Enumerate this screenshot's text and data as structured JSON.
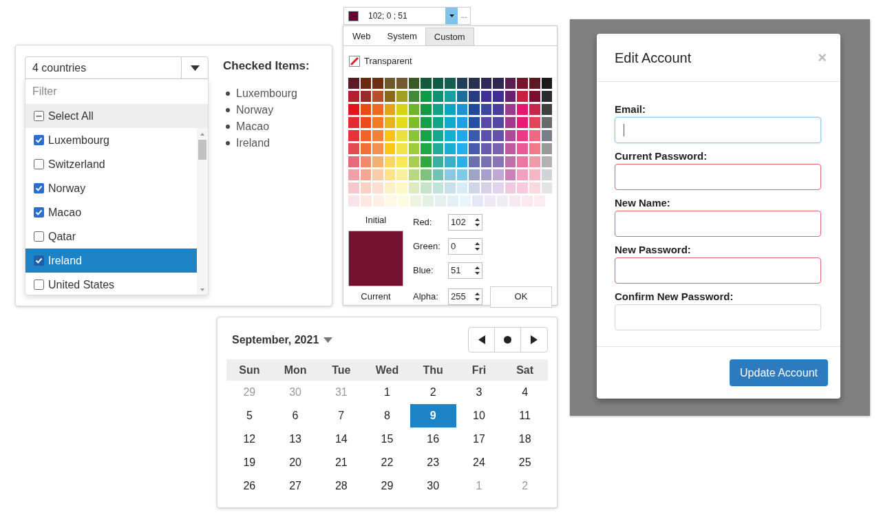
{
  "country_select": {
    "summary": "4 countries",
    "filter_placeholder": "Filter",
    "select_all": {
      "label": "Select All",
      "indeterminate": true
    },
    "items": [
      {
        "label": "Luxembourg",
        "checked": true,
        "selected": false
      },
      {
        "label": "Switzerland",
        "checked": false,
        "selected": false
      },
      {
        "label": "Norway",
        "checked": true,
        "selected": false
      },
      {
        "label": "Macao",
        "checked": true,
        "selected": false
      },
      {
        "label": "Qatar",
        "checked": false,
        "selected": false
      },
      {
        "label": "Ireland",
        "checked": true,
        "selected": true
      },
      {
        "label": "United States",
        "checked": false,
        "selected": false
      }
    ]
  },
  "checked_items": {
    "title": "Checked Items:",
    "items": [
      "Luxembourg",
      "Norway",
      "Macao",
      "Ireland"
    ]
  },
  "color_combo": {
    "value": "102; 0 ; 51",
    "color": "#660033",
    "more": "..."
  },
  "color_picker": {
    "tabs": [
      {
        "label": "Web",
        "selected": false
      },
      {
        "label": "System",
        "selected": false
      },
      {
        "label": "Custom",
        "selected": true
      }
    ],
    "transparent": "Transparent",
    "palette": [
      {
        "swatches": [
          {
            "color": "#5e1a24"
          },
          {
            "color": "#6b2a10"
          },
          {
            "color": "#6f2e0f"
          },
          {
            "color": "#6e5a2a"
          },
          {
            "color": "#735a32"
          },
          {
            "color": "#3a5a25"
          },
          {
            "color": "#125a3a"
          },
          {
            "color": "#0f5c46"
          },
          {
            "color": "#165e50"
          },
          {
            "color": "#233e5a"
          },
          {
            "color": "#2b2f50"
          },
          {
            "color": "#30275a"
          },
          {
            "color": "#2f2852"
          },
          {
            "color": "#5a1f4e"
          },
          {
            "color": "#74142f"
          },
          {
            "color": "#5e1a24"
          },
          {
            "color": "#1a1a1a"
          }
        ]
      },
      {
        "swatches": [
          {
            "color": "#b5202f"
          },
          {
            "color": "#9a2b2b"
          },
          {
            "color": "#b5502a"
          },
          {
            "color": "#8a6a1a"
          },
          {
            "color": "#a0a020"
          },
          {
            "color": "#428a38"
          },
          {
            "color": "#0c9a48"
          },
          {
            "color": "#109070"
          },
          {
            "color": "#14a0a0"
          },
          {
            "color": "#1e6e9a"
          },
          {
            "color": "#283a80"
          },
          {
            "color": "#40309a"
          },
          {
            "color": "#402f90"
          },
          {
            "color": "#6a2070"
          },
          {
            "color": "#c8203f"
          },
          {
            "color": "#7a1030"
          },
          {
            "color": "#2a2a30"
          }
        ]
      },
      {
        "swatches": [
          {
            "color": "#e3141c"
          },
          {
            "color": "#ea4a14"
          },
          {
            "color": "#ef6a1f"
          },
          {
            "color": "#e4a418"
          },
          {
            "color": "#d8d21a"
          },
          {
            "color": "#6fb52c"
          },
          {
            "color": "#119a44"
          },
          {
            "color": "#10a284"
          },
          {
            "color": "#0aa5bf"
          },
          {
            "color": "#1b94d6"
          },
          {
            "color": "#224a9a"
          },
          {
            "color": "#3c48a0"
          },
          {
            "color": "#4a3f9a"
          },
          {
            "color": "#9c3a8e"
          },
          {
            "color": "#e3186e"
          },
          {
            "color": "#c8264a"
          },
          {
            "color": "#404040"
          }
        ]
      },
      {
        "swatches": [
          {
            "color": "#e52a30"
          },
          {
            "color": "#ec4a1a"
          },
          {
            "color": "#f07c26"
          },
          {
            "color": "#e6b41c"
          },
          {
            "color": "#e3dc1a"
          },
          {
            "color": "#7ebc2c"
          },
          {
            "color": "#12a048"
          },
          {
            "color": "#12a488"
          },
          {
            "color": "#10abcc"
          },
          {
            "color": "#1ca0e0"
          },
          {
            "color": "#2350a0"
          },
          {
            "color": "#5a4aa8"
          },
          {
            "color": "#5448a0"
          },
          {
            "color": "#a23a90"
          },
          {
            "color": "#e81a76"
          },
          {
            "color": "#e0465a"
          },
          {
            "color": "#6a6a6a"
          }
        ]
      },
      {
        "swatches": [
          {
            "color": "#e83238"
          },
          {
            "color": "#f0642a"
          },
          {
            "color": "#f18238"
          },
          {
            "color": "#fac316"
          },
          {
            "color": "#e8e03c"
          },
          {
            "color": "#8ac43a"
          },
          {
            "color": "#14a24a"
          },
          {
            "color": "#14a890"
          },
          {
            "color": "#12b0d0"
          },
          {
            "color": "#1eaaea"
          },
          {
            "color": "#3a5aaa"
          },
          {
            "color": "#5a52aa"
          },
          {
            "color": "#6452a8"
          },
          {
            "color": "#b04a98"
          },
          {
            "color": "#ea3a86"
          },
          {
            "color": "#ee6a80"
          },
          {
            "color": "#7a7e88"
          }
        ]
      },
      {
        "swatches": [
          {
            "color": "#e44a52"
          },
          {
            "color": "#f07038"
          },
          {
            "color": "#f39050"
          },
          {
            "color": "#fcc818"
          },
          {
            "color": "#f0e44a"
          },
          {
            "color": "#9ccc3c"
          },
          {
            "color": "#20a848"
          },
          {
            "color": "#20ac98"
          },
          {
            "color": "#1aaed4"
          },
          {
            "color": "#20aeec"
          },
          {
            "color": "#4a5aaa"
          },
          {
            "color": "#6a5aae"
          },
          {
            "color": "#7a62ae"
          },
          {
            "color": "#c05a9e"
          },
          {
            "color": "#ec5a96"
          },
          {
            "color": "#ef7a8a"
          },
          {
            "color": "#999999"
          }
        ]
      },
      {
        "swatches": [
          {
            "color": "#e86a7a"
          },
          {
            "color": "#f08a6a"
          },
          {
            "color": "#f4b070"
          },
          {
            "color": "#fad860"
          },
          {
            "color": "#f6e85a"
          },
          {
            "color": "#a8d050"
          },
          {
            "color": "#30a840"
          },
          {
            "color": "#38b0a0"
          },
          {
            "color": "#3ab0c8"
          },
          {
            "color": "#2ab0e6"
          },
          {
            "color": "#6a70b0"
          },
          {
            "color": "#7a70b4"
          },
          {
            "color": "#8a74b4"
          },
          {
            "color": "#c070a8"
          },
          {
            "color": "#ee76a0"
          },
          {
            "color": "#f09aa8"
          },
          {
            "color": "#b2b2b2"
          }
        ]
      },
      {
        "swatches": [
          {
            "color": "#f0a0a8"
          },
          {
            "color": "#f2a890"
          },
          {
            "color": "#f8cca8"
          },
          {
            "color": "#fde08a"
          },
          {
            "color": "#f8f0a0"
          },
          {
            "color": "#b8d880"
          },
          {
            "color": "#80c080"
          },
          {
            "color": "#70c4b0"
          },
          {
            "color": "#8ec8e0"
          },
          {
            "color": "#80cae8"
          },
          {
            "color": "#9ea4c8"
          },
          {
            "color": "#a8a0cc"
          },
          {
            "color": "#c0a8d4"
          },
          {
            "color": "#cc80b8"
          },
          {
            "color": "#f0a0c0"
          },
          {
            "color": "#f4b8c4"
          },
          {
            "color": "#d0d4d8"
          }
        ]
      },
      {
        "swatches": [
          {
            "color": "#f4c8cc"
          },
          {
            "color": "#f8d0c4"
          },
          {
            "color": "#fae0d0"
          },
          {
            "color": "#fdf0c8"
          },
          {
            "color": "#fcf8c8"
          },
          {
            "color": "#dcecc0"
          },
          {
            "color": "#c8e4c8"
          },
          {
            "color": "#c0e4dc"
          },
          {
            "color": "#c8e0ec"
          },
          {
            "color": "#d8ecf8"
          },
          {
            "color": "#d0d4e8"
          },
          {
            "color": "#d8d0e8"
          },
          {
            "color": "#e0d4ec"
          },
          {
            "color": "#f0c8e0"
          },
          {
            "color": "#f8c8dc"
          },
          {
            "color": "#fad8e0"
          },
          {
            "color": "#e4e4e4"
          }
        ]
      },
      {
        "swatches": [
          {
            "color": "#f8e4e8"
          },
          {
            "color": "#fce8e0"
          },
          {
            "color": "#fcf0e4"
          },
          {
            "color": "#fef8e4"
          },
          {
            "color": "#fefce0"
          },
          {
            "color": "#ecf4e0"
          },
          {
            "color": "#e4f0e4"
          },
          {
            "color": "#e4f0f0"
          },
          {
            "color": "#e4f0f8"
          },
          {
            "color": "#e8f4fc"
          },
          {
            "color": "#e4e8f4"
          },
          {
            "color": "#ece8f4"
          },
          {
            "color": "#f0ecf4"
          },
          {
            "color": "#f8e8f0"
          },
          {
            "color": "#fce8f0"
          },
          {
            "color": "#fcecf0"
          }
        ]
      }
    ],
    "initial_label": "Initial",
    "current_label": "Current",
    "preview": {
      "color": "#751232"
    },
    "channels": [
      {
        "label": "Red:",
        "value": "102"
      },
      {
        "label": "Green:",
        "value": "0"
      },
      {
        "label": "Blue:",
        "value": "51"
      },
      {
        "label": "Alpha:",
        "value": "255"
      }
    ],
    "ok": "OK"
  },
  "calendar": {
    "title": "September, 2021",
    "weekdays": [
      "Sun",
      "Mon",
      "Tue",
      "Wed",
      "Thu",
      "Fri",
      "Sat"
    ],
    "weeks": [
      {
        "days": [
          {
            "label": "29",
            "muted": true,
            "selected": false
          },
          {
            "label": "30",
            "muted": true,
            "selected": false
          },
          {
            "label": "31",
            "muted": true,
            "selected": false
          },
          {
            "label": "1",
            "muted": false,
            "selected": false
          },
          {
            "label": "2",
            "muted": false,
            "selected": false
          },
          {
            "label": "3",
            "muted": false,
            "selected": false
          },
          {
            "label": "4",
            "muted": false,
            "selected": false
          }
        ]
      },
      {
        "days": [
          {
            "label": "5",
            "muted": false,
            "selected": false
          },
          {
            "label": "6",
            "muted": false,
            "selected": false
          },
          {
            "label": "7",
            "muted": false,
            "selected": false
          },
          {
            "label": "8",
            "muted": false,
            "selected": false
          },
          {
            "label": "9",
            "muted": false,
            "selected": true
          },
          {
            "label": "10",
            "muted": false,
            "selected": false
          },
          {
            "label": "11",
            "muted": false,
            "selected": false
          }
        ]
      },
      {
        "days": [
          {
            "label": "12",
            "muted": false,
            "selected": false
          },
          {
            "label": "13",
            "muted": false,
            "selected": false
          },
          {
            "label": "14",
            "muted": false,
            "selected": false
          },
          {
            "label": "15",
            "muted": false,
            "selected": false
          },
          {
            "label": "16",
            "muted": false,
            "selected": false
          },
          {
            "label": "17",
            "muted": false,
            "selected": false
          },
          {
            "label": "18",
            "muted": false,
            "selected": false
          }
        ]
      },
      {
        "days": [
          {
            "label": "19",
            "muted": false,
            "selected": false
          },
          {
            "label": "20",
            "muted": false,
            "selected": false
          },
          {
            "label": "21",
            "muted": false,
            "selected": false
          },
          {
            "label": "22",
            "muted": false,
            "selected": false
          },
          {
            "label": "23",
            "muted": false,
            "selected": false
          },
          {
            "label": "24",
            "muted": false,
            "selected": false
          },
          {
            "label": "25",
            "muted": false,
            "selected": false
          }
        ]
      },
      {
        "days": [
          {
            "label": "26",
            "muted": false,
            "selected": false
          },
          {
            "label": "27",
            "muted": false,
            "selected": false
          },
          {
            "label": "28",
            "muted": false,
            "selected": false
          },
          {
            "label": "29",
            "muted": false,
            "selected": false
          },
          {
            "label": "30",
            "muted": false,
            "selected": false
          },
          {
            "label": "1",
            "muted": true,
            "selected": false
          },
          {
            "label": "2",
            "muted": true,
            "selected": false
          }
        ]
      }
    ]
  },
  "dialog": {
    "title": "Edit Account",
    "close": "×",
    "fields": [
      {
        "label": "Email:",
        "focused": true,
        "invalid": false
      },
      {
        "label": "Current Password:",
        "focused": false,
        "invalid": true
      },
      {
        "label": "New Name:",
        "focused": false,
        "invalid": true
      },
      {
        "label": "New Password:",
        "focused": false,
        "invalid": true
      },
      {
        "label": "Confirm New Password:",
        "focused": false,
        "invalid": false
      }
    ],
    "submit": "Update Account"
  }
}
